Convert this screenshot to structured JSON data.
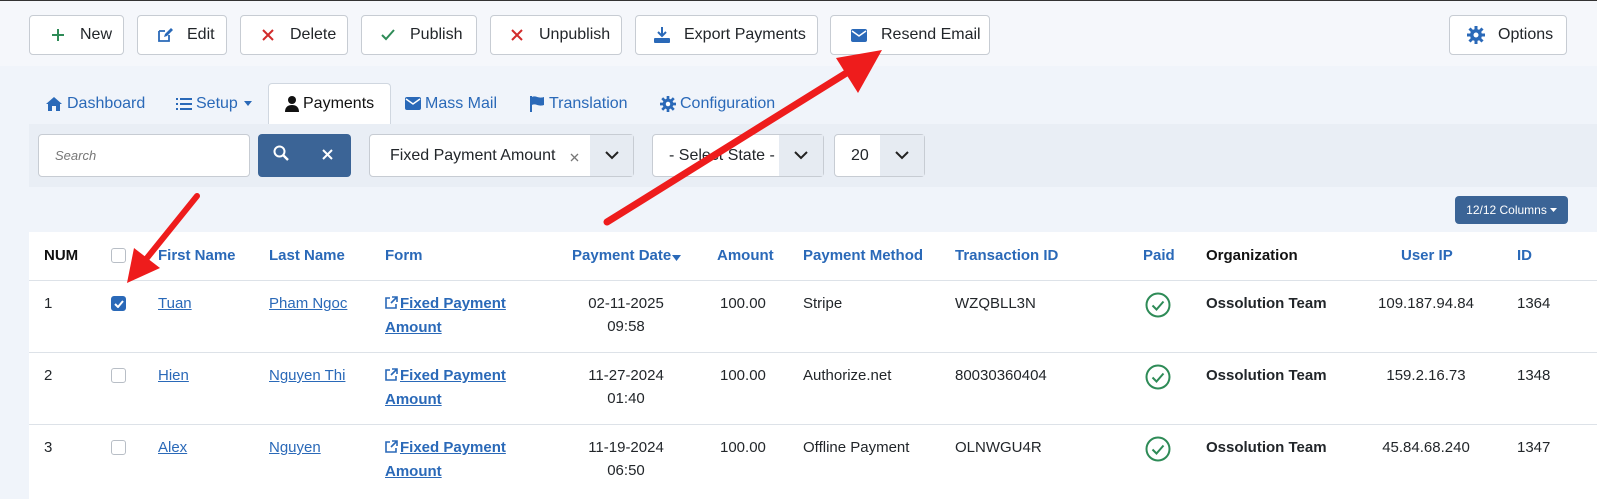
{
  "toolbar": {
    "new": "New",
    "edit": "Edit",
    "delete": "Delete",
    "publish": "Publish",
    "unpublish": "Unpublish",
    "export": "Export Payments",
    "resend": "Resend Email",
    "options": "Options"
  },
  "tabs": {
    "dashboard": "Dashboard",
    "setup": "Setup",
    "payments": "Payments",
    "massmail": "Mass Mail",
    "translation": "Translation",
    "configuration": "Configuration"
  },
  "filters": {
    "search_placeholder": "Search",
    "form_filter": "Fixed Payment Amount",
    "state_filter": "- Select State -",
    "limit": "20"
  },
  "columns_button": "12/12 Columns",
  "headers": {
    "num": "NUM",
    "first": "First Name",
    "last": "Last Name",
    "form": "Form",
    "date": "Payment Date",
    "amount": "Amount",
    "method": "Payment Method",
    "txn": "Transaction ID",
    "paid": "Paid",
    "org": "Organization",
    "ip": "User IP",
    "id": "ID"
  },
  "rows": [
    {
      "num": "1",
      "first": "Tuan",
      "last": "Pham Ngoc",
      "form1": "Fixed Payment",
      "form2": "Amount",
      "date": "02-11-2025",
      "time": "09:58",
      "amount": "100.00",
      "method": "Stripe",
      "txn": "WZQBLL3N",
      "org": "Ossolution Team",
      "ip": "109.187.94.84",
      "id": "1364",
      "checked": true
    },
    {
      "num": "2",
      "first": "Hien",
      "last": "Nguyen Thi",
      "form1": "Fixed Payment",
      "form2": "Amount",
      "date": "11-27-2024",
      "time": "01:40",
      "amount": "100.00",
      "method": "Authorize.net",
      "txn": "80030360404",
      "org": "Ossolution Team",
      "ip": "159.2.16.73",
      "id": "1348",
      "checked": false
    },
    {
      "num": "3",
      "first": "Alex",
      "last": "Nguyen",
      "form1": "Fixed Payment",
      "form2": "Amount",
      "date": "11-19-2024",
      "time": "06:50",
      "amount": "100.00",
      "method": "Offline Payment",
      "txn": "OLNWGU4R",
      "org": "Ossolution Team",
      "ip": "45.84.68.240",
      "id": "1347",
      "checked": false
    }
  ],
  "colors": {
    "accent": "#2a69b8",
    "primary_button": "#3b6496",
    "annotation_arrow": "#ee1c1c",
    "paid_green": "#2e8b57"
  }
}
